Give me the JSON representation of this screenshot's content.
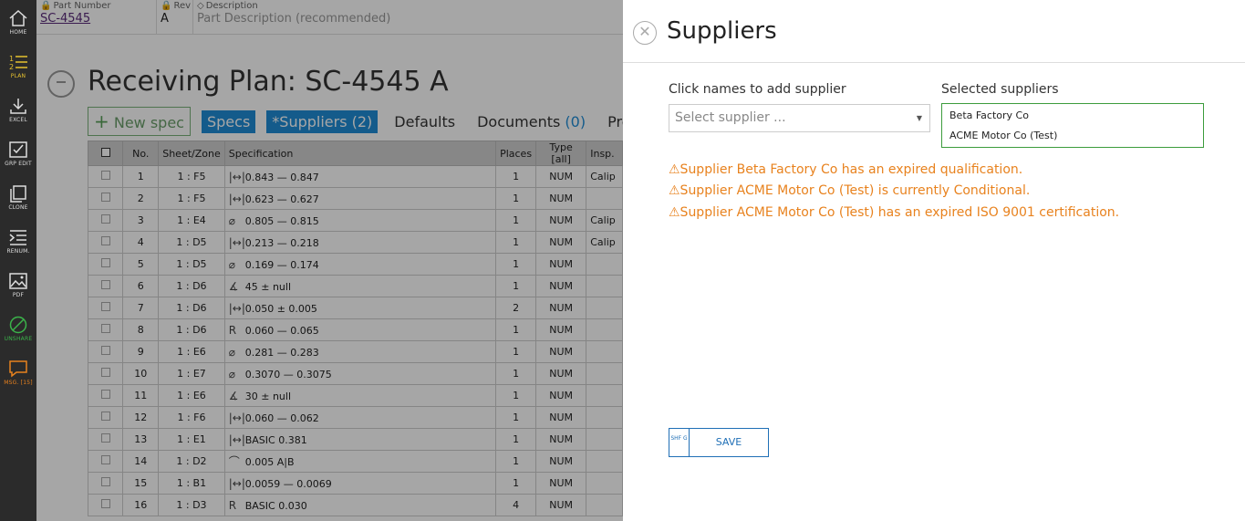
{
  "sidebar": {
    "items": [
      {
        "label": "HOME",
        "icon": "home-icon",
        "color": "#dddddd"
      },
      {
        "label": "PLAN",
        "icon": "plan-list-icon",
        "color": "#e6c12f"
      },
      {
        "label": "EXCEL",
        "icon": "download-icon",
        "color": "#dddddd"
      },
      {
        "label": "GRP EDIT",
        "icon": "group-edit-icon",
        "color": "#dddddd"
      },
      {
        "label": "CLONE",
        "icon": "clone-icon",
        "color": "#dddddd"
      },
      {
        "label": "RENUM.",
        "icon": "renumber-icon",
        "color": "#dddddd"
      },
      {
        "label": "PDF",
        "icon": "image-icon",
        "color": "#dddddd"
      },
      {
        "label": "UNSHARE",
        "icon": "unshare-icon",
        "color": "#3bb34a"
      },
      {
        "label": "MSG. [15]",
        "icon": "message-icon",
        "color": "#e8821e"
      }
    ]
  },
  "header": {
    "part_number_caption": "Part Number",
    "part_number": "SC-4545",
    "rev_caption": "Rev",
    "rev": "A",
    "description_caption": "Description",
    "description_placeholder": "Part Description (recommended)"
  },
  "main": {
    "title": "Receiving Plan: SC-4545 A",
    "tabs": [
      {
        "label": "New spec"
      },
      {
        "label": "Specs"
      },
      {
        "label": "*Suppliers (2)"
      },
      {
        "label": "Defaults"
      },
      {
        "label": "Documents",
        "count": "(0)"
      },
      {
        "label": "Properties"
      }
    ],
    "columns": [
      "No.",
      "Sheet/Zone",
      "Specification",
      "Places",
      "Type [all]",
      "Insp."
    ],
    "rows": [
      {
        "no": "1",
        "zone": "1 : F5",
        "icon": "|↔|",
        "spec": "0.843 — 0.847",
        "places": "1",
        "type": "NUM",
        "insp": "Calip"
      },
      {
        "no": "2",
        "zone": "1 : F5",
        "icon": "|↔|",
        "spec": "0.623 — 0.627",
        "places": "1",
        "type": "NUM",
        "insp": ""
      },
      {
        "no": "3",
        "zone": "1 : E4",
        "icon": "⌀",
        "spec": "0.805 — 0.815",
        "places": "1",
        "type": "NUM",
        "insp": "Calip"
      },
      {
        "no": "4",
        "zone": "1 : D5",
        "icon": "|↔|",
        "spec": "0.213 — 0.218",
        "places": "1",
        "type": "NUM",
        "insp": "Calip"
      },
      {
        "no": "5",
        "zone": "1 : D5",
        "icon": "⌀",
        "spec": "0.169 — 0.174",
        "places": "1",
        "type": "NUM",
        "insp": ""
      },
      {
        "no": "6",
        "zone": "1 : D6",
        "icon": "∡",
        "spec": "45 ± null",
        "places": "1",
        "type": "NUM",
        "insp": ""
      },
      {
        "no": "7",
        "zone": "1 : D6",
        "icon": "|↔|",
        "spec": "0.050 ± 0.005",
        "places": "2",
        "type": "NUM",
        "insp": ""
      },
      {
        "no": "8",
        "zone": "1 : D6",
        "icon": "R",
        "spec": "0.060 — 0.065",
        "places": "1",
        "type": "NUM",
        "insp": ""
      },
      {
        "no": "9",
        "zone": "1 : E6",
        "icon": "⌀",
        "spec": "0.281 — 0.283",
        "places": "1",
        "type": "NUM",
        "insp": ""
      },
      {
        "no": "10",
        "zone": "1 : E7",
        "icon": "⌀",
        "spec": "0.3070 — 0.3075",
        "places": "1",
        "type": "NUM",
        "insp": ""
      },
      {
        "no": "11",
        "zone": "1 : E6",
        "icon": "∡",
        "spec": "30 ± null",
        "places": "1",
        "type": "NUM",
        "insp": ""
      },
      {
        "no": "12",
        "zone": "1 : F6",
        "icon": "|↔|",
        "spec": "0.060 — 0.062",
        "places": "1",
        "type": "NUM",
        "insp": ""
      },
      {
        "no": "13",
        "zone": "1 : E1",
        "icon": "|↔|",
        "spec": "BASIC 0.381",
        "places": "1",
        "type": "NUM",
        "insp": ""
      },
      {
        "no": "14",
        "zone": "1 : D2",
        "icon": "⌒",
        "spec": "0.005 A|B",
        "places": "1",
        "type": "NUM",
        "insp": ""
      },
      {
        "no": "15",
        "zone": "1 : B1",
        "icon": "|↔|",
        "spec": "0.0059 — 0.0069",
        "places": "1",
        "type": "NUM",
        "insp": ""
      },
      {
        "no": "16",
        "zone": "1 : D3",
        "icon": "R",
        "spec": "BASIC 0.030",
        "places": "4",
        "type": "NUM",
        "insp": ""
      }
    ]
  },
  "panel": {
    "title": "Suppliers",
    "add_label": "Click names to add supplier",
    "select_placeholder": "Select supplier ...",
    "selected_label": "Selected suppliers",
    "selected": [
      "Beta Factory Co",
      "ACME Motor Co (Test)"
    ],
    "warnings": [
      "⚠Supplier Beta Factory Co has an expired qualification.",
      "⚠Supplier ACME Motor Co (Test) is currently Conditional.",
      "⚠Supplier ACME Motor Co (Test) has an expired ISO 9001 certification."
    ],
    "save_shortcut": "SHF G",
    "save_label": "SAVE"
  },
  "colors": {
    "warning": "#e8821e",
    "accent": "#1f8cd6",
    "selected_border": "#3c9c3c"
  }
}
